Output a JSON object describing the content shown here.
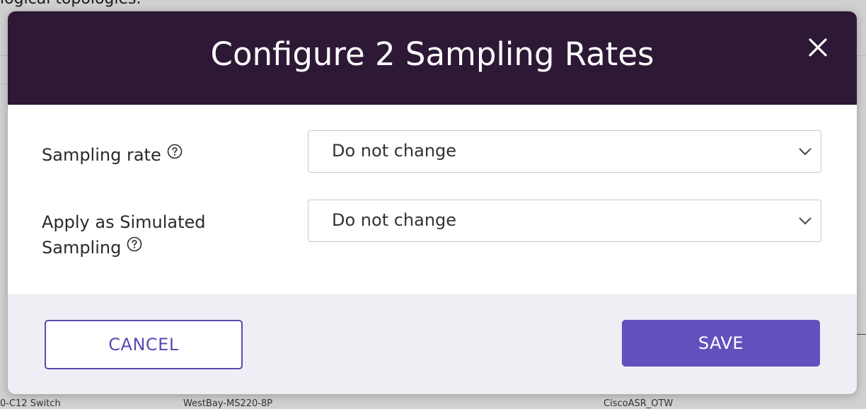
{
  "background": {
    "top_text": "logical topologies.",
    "bottom_items": [
      "0-C12 Switch",
      "WestBay-MS220-8P",
      "CiscoASR_OTW"
    ]
  },
  "modal": {
    "title": "Configure 2 Sampling Rates",
    "close_icon": "close-icon",
    "fields": [
      {
        "label": "Sampling rate",
        "value": "Do not change",
        "help_icon": "question-circle-icon"
      },
      {
        "label_line1": "Apply as Simulated",
        "label_line2": "Sampling",
        "value": "Do not change",
        "help_icon": "question-circle-icon"
      }
    ],
    "footer": {
      "cancel_label": "CANCEL",
      "save_label": "SAVE"
    }
  },
  "colors": {
    "header_bg": "#2d1935",
    "accent": "#6450bd",
    "footer_bg": "#eeeff5"
  }
}
